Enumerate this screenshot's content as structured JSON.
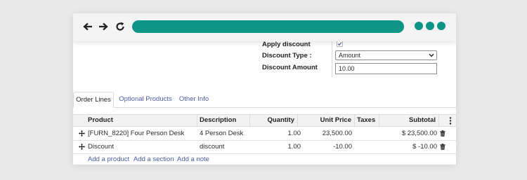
{
  "colors": {
    "accent": "#0f9488",
    "link": "#4b5ea4"
  },
  "browser": {
    "back_icon": "arrow-left-icon",
    "forward_icon": "arrow-right-icon",
    "reload_icon": "reload-icon"
  },
  "form": {
    "apply_discount": {
      "label": "Apply discount",
      "checked": true
    },
    "discount_type": {
      "label": "Discount Type :",
      "value": "Amount"
    },
    "discount_amount": {
      "label": "Discount Amount",
      "value": "10.00"
    }
  },
  "tabs": [
    {
      "label": "Order Lines",
      "active": true
    },
    {
      "label": "Optional Products",
      "active": false
    },
    {
      "label": "Other Info",
      "active": false
    }
  ],
  "table": {
    "headers": {
      "product": "Product",
      "description": "Description",
      "quantity": "Quantity",
      "unit_price": "Unit Price",
      "taxes": "Taxes",
      "subtotal": "Subtotal",
      "options_icon": "kebab-menu-icon"
    },
    "rows": [
      {
        "product": "[FURN_8220] Four Person Desk",
        "description": "4 Person Desk",
        "quantity": "1.00",
        "unit_price": "23,500.00",
        "taxes": "",
        "subtotal": "$ 23,500.00"
      },
      {
        "product": "Discount",
        "description": "discount",
        "quantity": "1.00",
        "unit_price": "-10.00",
        "taxes": "",
        "subtotal": "$ -10.00"
      }
    ]
  },
  "actions": {
    "add_product": "Add a product",
    "add_section": "Add a section",
    "add_note": "Add a note"
  }
}
